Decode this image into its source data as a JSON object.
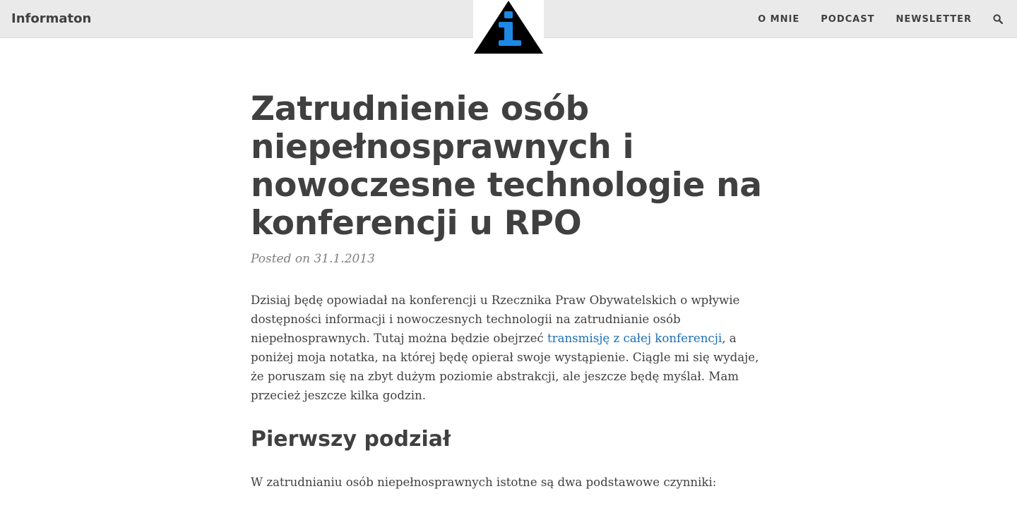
{
  "header": {
    "brand": "Informaton",
    "nav": [
      {
        "label": "O MNIE"
      },
      {
        "label": "PODCAST"
      },
      {
        "label": "NEWSLETTER"
      }
    ],
    "search_icon": "search-icon",
    "logo_icon": "info-triangle-icon",
    "colors": {
      "bar": "#eaeaea",
      "logo_triangle": "#000000",
      "logo_i": "#1e88e5"
    }
  },
  "article": {
    "title": "Zatrudnienie osób niepełnosprawnych i nowoczesne technologie na konferencji u RPO",
    "posted": "Posted on 31.1.2013",
    "intro": {
      "before_link": "Dzisiaj będę opowiadał na konferencji u Rzecznika Praw Obywatelskich o wpływie dostępności informacji i nowoczesnych technologii na zatrudnianie osób niepełnosprawnych. Tutaj można będzie obejrzeć ",
      "link_text": "transmisję z całej konferencji",
      "after_link": ", a poniżej moja notatka, na której będę opierał swoje wystąpienie. Ciągle mi się wydaje, że poruszam się na zbyt dużym poziomie abstrakcji, ale jeszcze będę myślał. Mam przecież jeszcze kilka godzin."
    },
    "section_heading": "Pierwszy podział",
    "section_text": "W zatrudnianiu osób niepełnosprawnych istotne są dwa podstawowe czynniki:",
    "colors": {
      "text": "#404040",
      "meta": "#808080",
      "link": "#1a6fb6"
    }
  }
}
